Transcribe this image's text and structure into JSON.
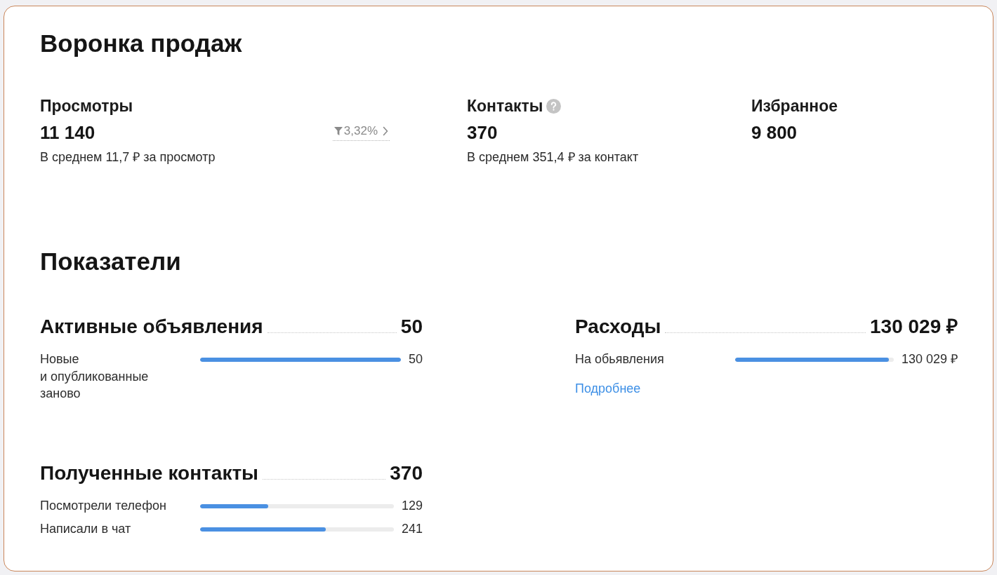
{
  "funnel": {
    "title": "Воронка продаж",
    "metrics": [
      {
        "label": "Просмотры",
        "help": false,
        "value": "11 140",
        "conversion": "3,32%",
        "note": "В среднем 11,7 ₽ за просмотр"
      },
      {
        "label": "Контакты",
        "help": true,
        "value": "370",
        "note": "В среднем 351,4 ₽ за контакт"
      },
      {
        "label": "Избранное",
        "help": false,
        "value": "9 800"
      }
    ]
  },
  "indicators": {
    "title": "Показатели",
    "columns": [
      {
        "groups": [
          {
            "title": "Активные объявления",
            "total": "50",
            "rows": [
              {
                "label": "Новые и опубликованные заново",
                "level": 1.0,
                "value": "50"
              }
            ]
          },
          {
            "title": "Полученные контакты",
            "total": "370",
            "rows": [
              {
                "label": "Посмотрели телефон",
                "level": 0.35,
                "value": "129"
              },
              {
                "label": "Написали в чат",
                "level": 0.65,
                "value": "241"
              }
            ]
          }
        ]
      },
      {
        "groups": [
          {
            "title": "Расходы",
            "total": "130 029 ₽",
            "rows": [
              {
                "label": "На обьявления",
                "level": 0.97,
                "value": "130 029 ₽"
              }
            ],
            "link": "Подробнее"
          }
        ]
      }
    ]
  }
}
